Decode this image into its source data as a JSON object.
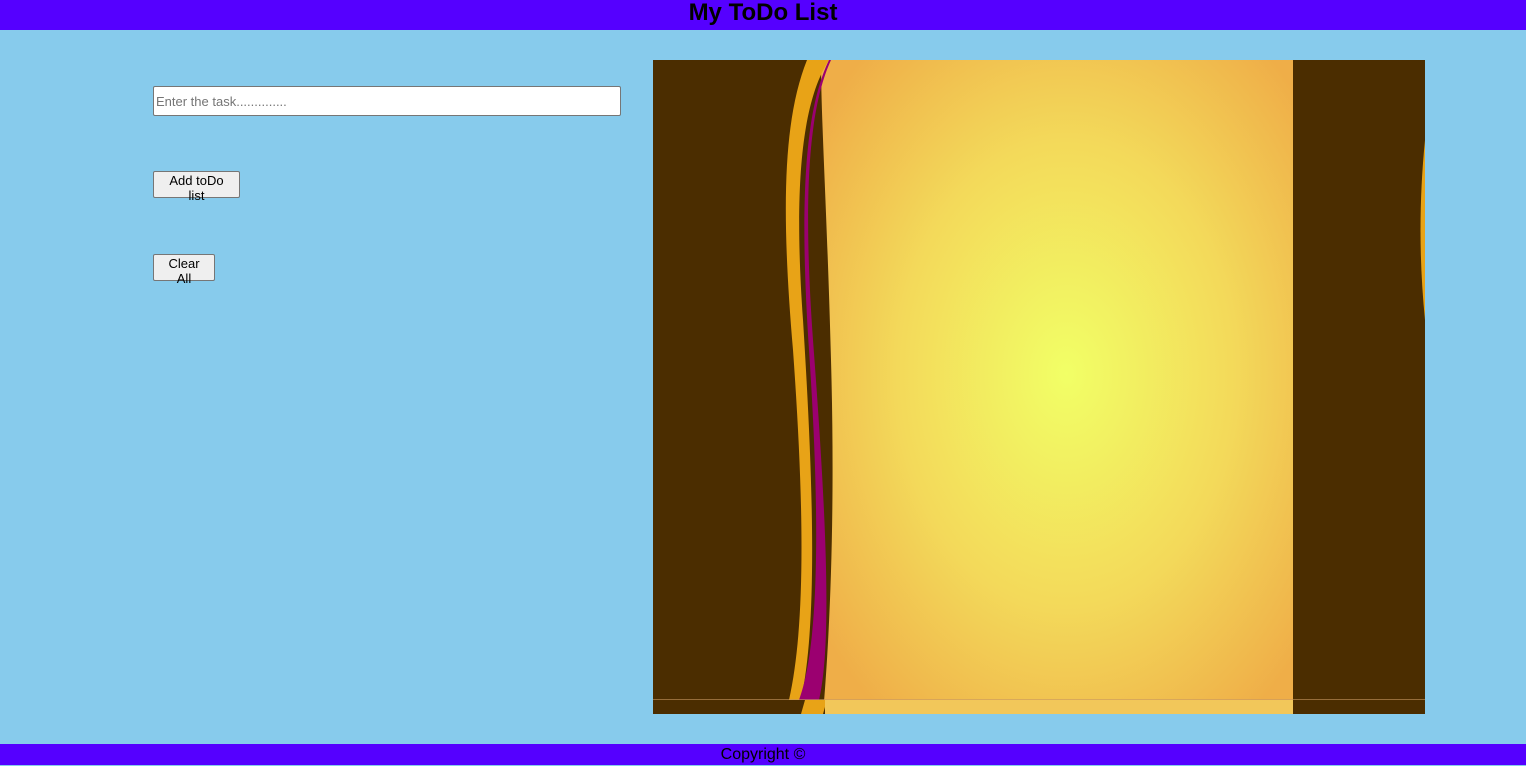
{
  "header": {
    "title": "My ToDo List"
  },
  "form": {
    "task_placeholder": "Enter the task..............",
    "task_value": "",
    "add_label": "Add toDo list",
    "clear_label": "Clear All"
  },
  "footer": {
    "copyright": "Copyright ©"
  },
  "colors": {
    "header_bg": "#5500FF",
    "page_bg": "#87CBEC",
    "art_dark": "#4B2D00",
    "art_gold": "#E8A317",
    "art_magenta": "#9B0070",
    "art_glow_center": "#F2FF66",
    "art_glow_edge": "#F0B34A"
  }
}
